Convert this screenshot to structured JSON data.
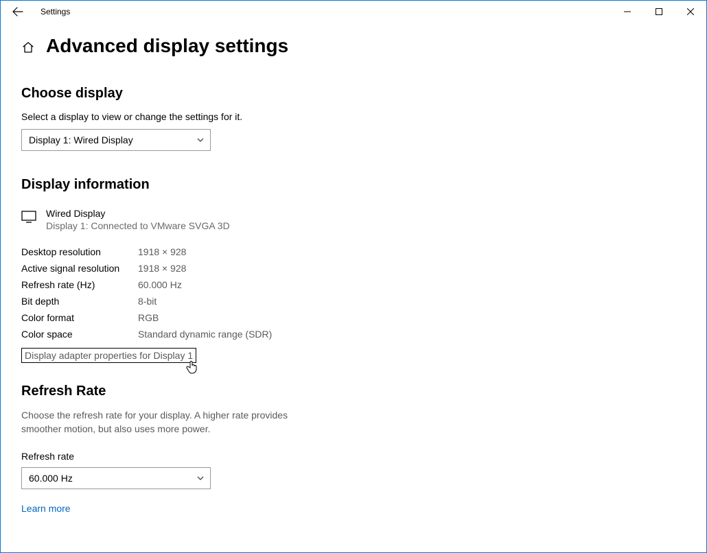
{
  "window": {
    "title": "Settings"
  },
  "page": {
    "title": "Advanced display settings"
  },
  "choose_display": {
    "heading": "Choose display",
    "subtext": "Select a display to view or change the settings for it.",
    "selected": "Display 1: Wired Display"
  },
  "display_info": {
    "heading": "Display information",
    "name": "Wired Display",
    "subtitle": "Display 1: Connected to VMware SVGA 3D",
    "rows": [
      {
        "label": "Desktop resolution",
        "value": "1918 × 928"
      },
      {
        "label": "Active signal resolution",
        "value": "1918 × 928"
      },
      {
        "label": "Refresh rate (Hz)",
        "value": "60.000 Hz"
      },
      {
        "label": "Bit depth",
        "value": "8-bit"
      },
      {
        "label": "Color format",
        "value": "RGB"
      },
      {
        "label": "Color space",
        "value": "Standard dynamic range (SDR)"
      }
    ],
    "adapter_link": "Display adapter properties for Display 1"
  },
  "refresh_rate": {
    "heading": "Refresh Rate",
    "description": "Choose the refresh rate for your display. A higher rate provides smoother motion, but also uses more power.",
    "field_label": "Refresh rate",
    "selected": "60.000 Hz",
    "learn_more": "Learn more"
  }
}
